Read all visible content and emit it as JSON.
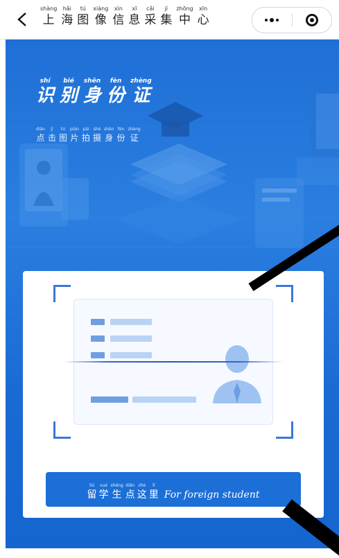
{
  "nav": {
    "title": [
      {
        "py": "shàng",
        "hz": "上"
      },
      {
        "py": "hǎi",
        "hz": "海"
      },
      {
        "py": "tú",
        "hz": "图"
      },
      {
        "py": "xiàng",
        "hz": "像"
      },
      {
        "py": "xìn",
        "hz": "信"
      },
      {
        "py": "xī",
        "hz": "息"
      },
      {
        "py": "cǎi",
        "hz": "采"
      },
      {
        "py": "jí",
        "hz": "集"
      },
      {
        "py": "zhōng",
        "hz": "中"
      },
      {
        "py": "xīn",
        "hz": "心"
      }
    ]
  },
  "hero": {
    "title": [
      {
        "py": "shí",
        "hz": "识"
      },
      {
        "py": "bié",
        "hz": "别"
      },
      {
        "py": "shēn",
        "hz": "身"
      },
      {
        "py": "fèn",
        "hz": "份"
      },
      {
        "py": "zhèng",
        "hz": "证"
      }
    ],
    "subtitle": [
      {
        "py": "diǎn",
        "hz": "点"
      },
      {
        "py": "jī",
        "hz": "击"
      },
      {
        "py": "tú",
        "hz": "图"
      },
      {
        "py": "piàn",
        "hz": "片"
      },
      {
        "py": "pāi",
        "hz": "拍"
      },
      {
        "py": "shè",
        "hz": "摄"
      },
      {
        "py": "shēn",
        "hz": "身"
      },
      {
        "py": "fèn",
        "hz": "份"
      },
      {
        "py": "zhèng",
        "hz": "证"
      }
    ]
  },
  "card": {
    "button": {
      "cn": [
        {
          "py": "liú",
          "hz": "留"
        },
        {
          "py": "xué",
          "hz": "学"
        },
        {
          "py": "shēng",
          "hz": "生"
        },
        {
          "py": "diǎn",
          "hz": "点"
        },
        {
          "py": "zhè",
          "hz": "这"
        },
        {
          "py": "lǐ",
          "hz": "里"
        }
      ],
      "en": "For foreign student"
    }
  },
  "colors": {
    "hero_blue": "#2a7fe0",
    "accent": "#3a78d6",
    "button": "#1b6fd6"
  },
  "icons": [
    "back-arrow-icon",
    "more-dots-icon",
    "close-target-icon"
  ]
}
